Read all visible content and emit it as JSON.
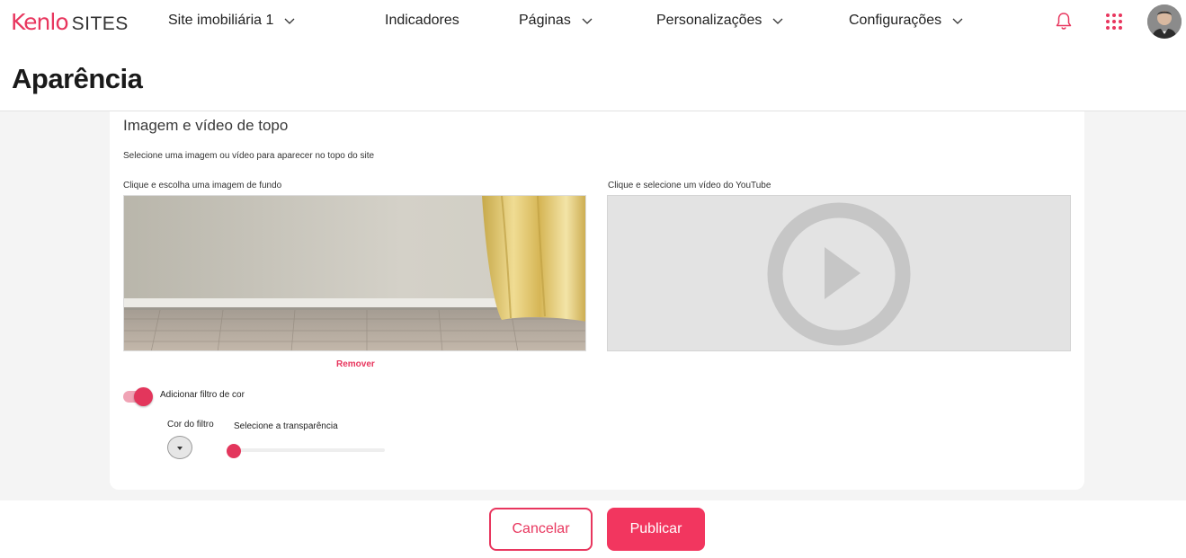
{
  "header": {
    "brand": "Kenlo",
    "product": "SITES",
    "nav": {
      "site": "Site imobiliária 1",
      "indicadores": "Indicadores",
      "paginas": "Páginas",
      "personalizacoes": "Personalizações",
      "configuracoes": "Configurações"
    },
    "icons": [
      "bell-icon",
      "apps-grid-icon",
      "avatar"
    ]
  },
  "page": {
    "title": "Aparência"
  },
  "section": {
    "title": "Imagem e vídeo de topo",
    "description": "Selecione uma imagem ou vídeo para aparecer no topo do site",
    "image_label": "Clique e escolha uma imagem de fundo",
    "video_label": "Clique e selecione um vídeo do YouTube",
    "remove_label": "Remover",
    "filter_toggle_label": "Adicionar filtro de cor",
    "filter_toggle_on": true,
    "filter_color_label": "Cor do filtro",
    "transparency_label": "Selecione a transparência",
    "transparency_value": 0
  },
  "footer": {
    "cancel_label": "Cancelar",
    "publish_label": "Publicar"
  },
  "colors": {
    "accent": "#e8365e",
    "background": "#f4f4f4",
    "card": "#ffffff"
  }
}
